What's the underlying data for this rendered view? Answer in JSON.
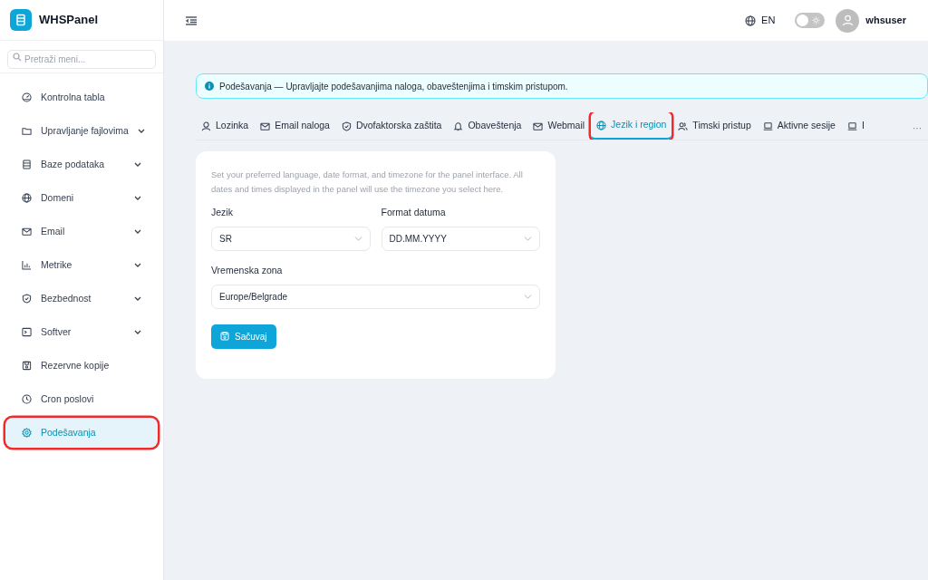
{
  "brand": {
    "name": "WHSPanel"
  },
  "sidebar": {
    "search": {
      "placeholder": "Pretraži meni..."
    },
    "items": [
      {
        "label": "Kontrolna tabla",
        "expandable": false,
        "selected": false,
        "highlighted": false
      },
      {
        "label": "Upravljanje fajlovima",
        "expandable": true,
        "selected": false,
        "highlighted": false
      },
      {
        "label": "Baze podataka",
        "expandable": true,
        "selected": false,
        "highlighted": false
      },
      {
        "label": "Domeni",
        "expandable": true,
        "selected": false,
        "highlighted": false
      },
      {
        "label": "Email",
        "expandable": true,
        "selected": false,
        "highlighted": false
      },
      {
        "label": "Metrike",
        "expandable": true,
        "selected": false,
        "highlighted": false
      },
      {
        "label": "Bezbednost",
        "expandable": true,
        "selected": false,
        "highlighted": false
      },
      {
        "label": "Softver",
        "expandable": true,
        "selected": false,
        "highlighted": false
      },
      {
        "label": "Rezervne kopije",
        "expandable": false,
        "selected": false,
        "highlighted": false
      },
      {
        "label": "Cron poslovi",
        "expandable": false,
        "selected": false,
        "highlighted": false
      },
      {
        "label": "Podešavanja",
        "expandable": false,
        "selected": true,
        "highlighted": true
      }
    ]
  },
  "header": {
    "language": "EN",
    "dark_mode": false,
    "user": "whsuser"
  },
  "info_banner": {
    "text": "Podešavanja — Upravljajte podešavanjima naloga, obaveštenjima i timskim pristupom."
  },
  "tabs": [
    {
      "label": "Lozinka",
      "selected": false,
      "highlighted": false
    },
    {
      "label": "Email naloga",
      "selected": false,
      "highlighted": false
    },
    {
      "label": "Dvofaktorska zaštita",
      "selected": false,
      "highlighted": false
    },
    {
      "label": "Obaveštenja",
      "selected": false,
      "highlighted": false
    },
    {
      "label": "Webmail",
      "selected": false,
      "highlighted": false
    },
    {
      "label": "Jezik i region",
      "selected": true,
      "highlighted": true
    },
    {
      "label": "Timski pristup",
      "selected": false,
      "highlighted": false
    },
    {
      "label": "Aktivne sesije",
      "selected": false,
      "highlighted": false
    },
    {
      "label": "I",
      "selected": false,
      "highlighted": false
    }
  ],
  "tabs_more": "···",
  "form": {
    "description": "Set your preferred language, date format, and timezone for the panel interface. All dates and times displayed in the panel will use the timezone you select here.",
    "fields": [
      {
        "label": "Jezik",
        "value": "SR"
      },
      {
        "label": "Format datuma",
        "value": "DD.MM.YYYY"
      },
      {
        "label": "Vremenska zona",
        "value": "Europe/Belgrade"
      }
    ],
    "save_button": "Sačuvaj"
  }
}
